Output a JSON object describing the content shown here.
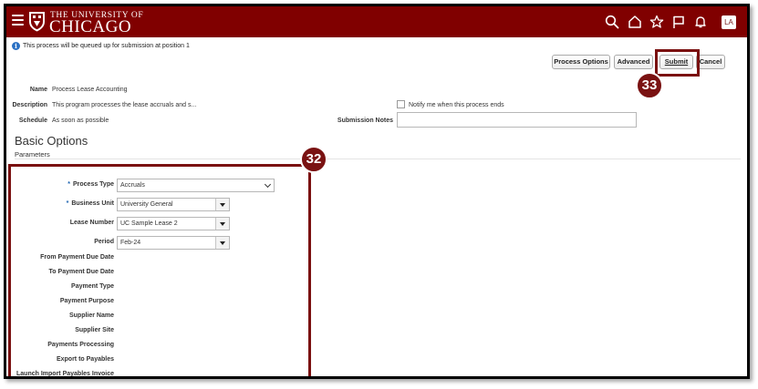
{
  "header": {
    "logo_line1": "THE UNIVERSITY OF",
    "logo_line2": "CHICAGO",
    "icons": [
      "menu-icon",
      "search-icon",
      "home-icon",
      "favorites-icon",
      "flag-icon",
      "notifications-icon"
    ],
    "avatar_initials": "LA",
    "background_color": "#800000"
  },
  "info": {
    "message": "This process will be queued up for submission at position 1"
  },
  "toolbar": {
    "process_options": "Process Options",
    "advanced": "Advanced",
    "submit": "Submit",
    "cancel": "Cancel"
  },
  "form": {
    "name_label": "Name",
    "name_value": "Process Lease Accounting",
    "description_label": "Description",
    "description_value": "This program processes the lease accruals and s...",
    "schedule_label": "Schedule",
    "schedule_value": "As soon as possible",
    "notify_label": "Notify me when this process ends",
    "submission_notes_label": "Submission Notes",
    "submission_notes_value": ""
  },
  "basic_options": {
    "title": "Basic Options",
    "subtitle": "Parameters",
    "fields": [
      {
        "label": "Process Type",
        "value": "Accruals",
        "required": true
      },
      {
        "label": "Business Unit",
        "value": "University General",
        "required": true
      },
      {
        "label": "Lease Number",
        "value": "UC Sample Lease 2",
        "required": false
      },
      {
        "label": "Period",
        "value": "Feb-24",
        "required": false
      },
      {
        "label": "From Payment Due Date",
        "value": ""
      },
      {
        "label": "To Payment Due Date",
        "value": ""
      },
      {
        "label": "Payment Type",
        "value": ""
      },
      {
        "label": "Payment Purpose",
        "value": ""
      },
      {
        "label": "Supplier Name",
        "value": ""
      },
      {
        "label": "Supplier Site",
        "value": ""
      },
      {
        "label": "Payments Processing",
        "value": ""
      },
      {
        "label": "Export to Payables",
        "value": ""
      },
      {
        "label": "Launch Import Payables Invoice",
        "value": ""
      }
    ],
    "required_marker": "*"
  },
  "callouts": {
    "parameters_step": "32",
    "submit_step": "33",
    "color": "#7a1212"
  }
}
